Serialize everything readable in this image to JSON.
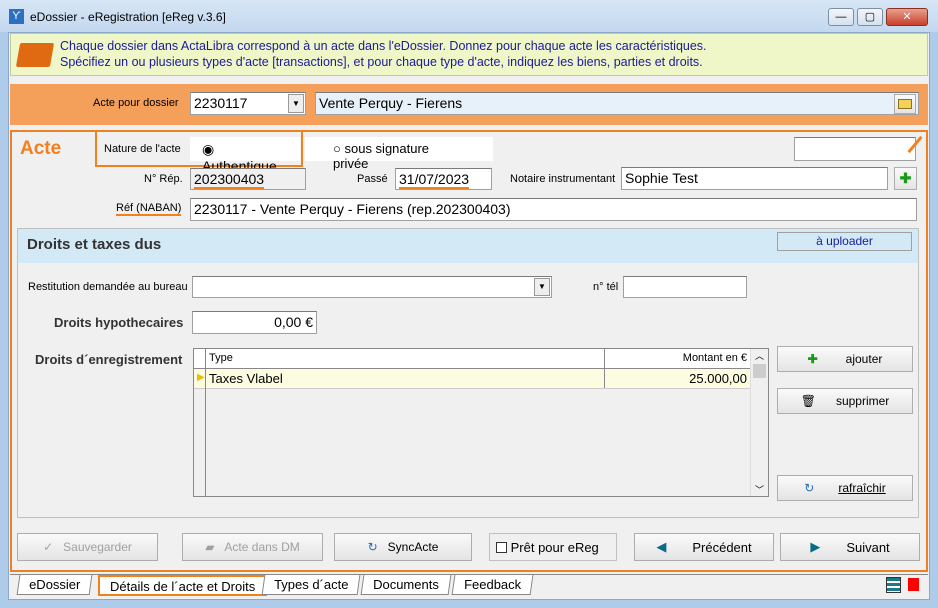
{
  "window": {
    "title": "eDossier - eRegistration [eReg v.3.6]",
    "minimize": "—",
    "maximize": "▢",
    "close": "✕"
  },
  "banner": {
    "line1": "Chaque dossier dans ActaLibra correspond à un acte dans l'eDossier.  Donnez pour chaque acte les caractéristiques.",
    "line2": "Spécifiez un ou plusieurs types d'acte [transactions], et pour chaque type d'acte, indiquez les biens, parties et droits."
  },
  "dossier": {
    "label": "Acte pour dossier",
    "value": "2230117",
    "description": "Vente Perquy - Fierens"
  },
  "acte": {
    "title": "Acte",
    "nature_label": "Nature de l'acte",
    "nature_options": [
      "Authentique",
      "sous signature privée"
    ],
    "nature_selected": "Authentique",
    "rep_label": "N° Rép.",
    "rep_value": "202300403",
    "passe_label": "Passé",
    "passe_value": "31/07/2023",
    "notaire_label": "Notaire instrumentant",
    "notaire_value": "Sophie Test",
    "ref_label": "Réf (NABAN)",
    "ref_value": "2230117 - Vente Perquy - Fierens (rep.202300403)"
  },
  "droits": {
    "title": "Droits et taxes dus",
    "status": "à uploader",
    "restitution_label": "Restitution demandée au bureau",
    "restitution_value": "",
    "tel_label": "n° tél",
    "tel_value": "",
    "hypo_label": "Droits hypothecaires",
    "hypo_value": "0,00 €",
    "enreg_label": "Droits d´enregistrement",
    "table": {
      "columns": [
        "Type",
        "Montant en €"
      ],
      "rows": [
        {
          "type": "Taxes Vlabel",
          "amount": "25.000,00"
        }
      ]
    },
    "add": "ajouter",
    "delete": "supprimer",
    "refresh": "rafraîchir"
  },
  "buttons": {
    "save": "Sauvegarder",
    "dm": "Acte dans DM",
    "sync": "SyncActe",
    "ready": "Prêt pour eReg",
    "prev": "Précédent",
    "next": "Suivant"
  },
  "tabs": [
    "eDossier",
    "Détails de l´acte et Droits",
    "Types d´acte",
    "Documents",
    "Feedback"
  ],
  "colors": {
    "accent": "#f08020",
    "header": "#d3e9f5"
  }
}
